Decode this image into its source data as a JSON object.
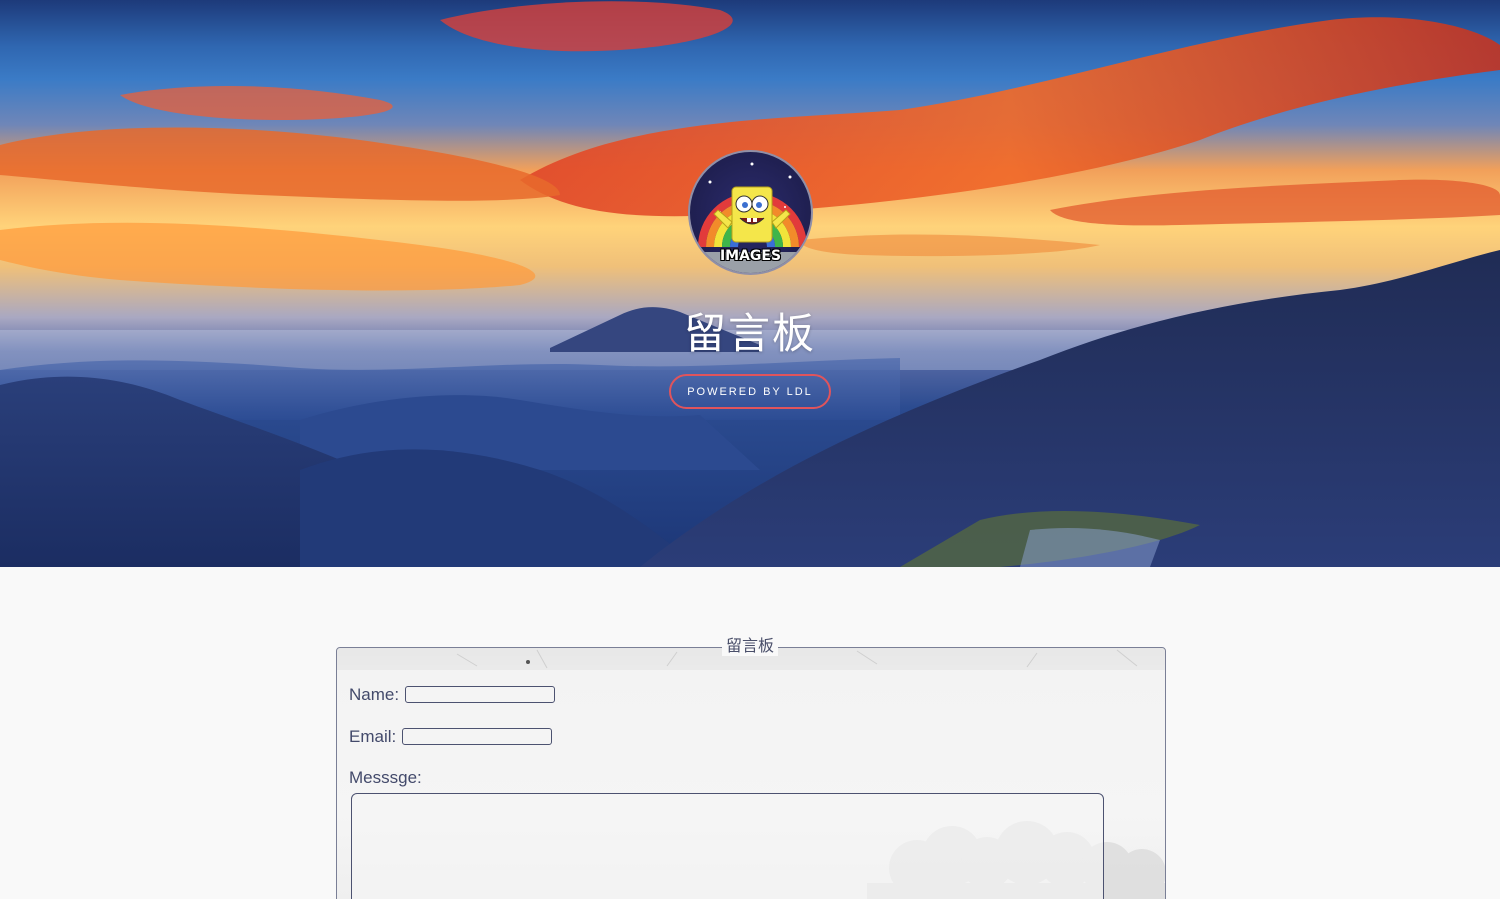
{
  "hero": {
    "avatar_caption": "IMAGES",
    "title": "留言板",
    "powered_button": "POWERED BY LDL"
  },
  "form": {
    "legend": "留言板",
    "name_label": "Name:",
    "name_value": "",
    "email_label": "Email:",
    "email_value": "",
    "message_label": "Messsge:",
    "message_value": ""
  },
  "colors": {
    "button_border": "#e0545c",
    "label_text": "#434a6b",
    "page_background": "#f9f9f9"
  }
}
